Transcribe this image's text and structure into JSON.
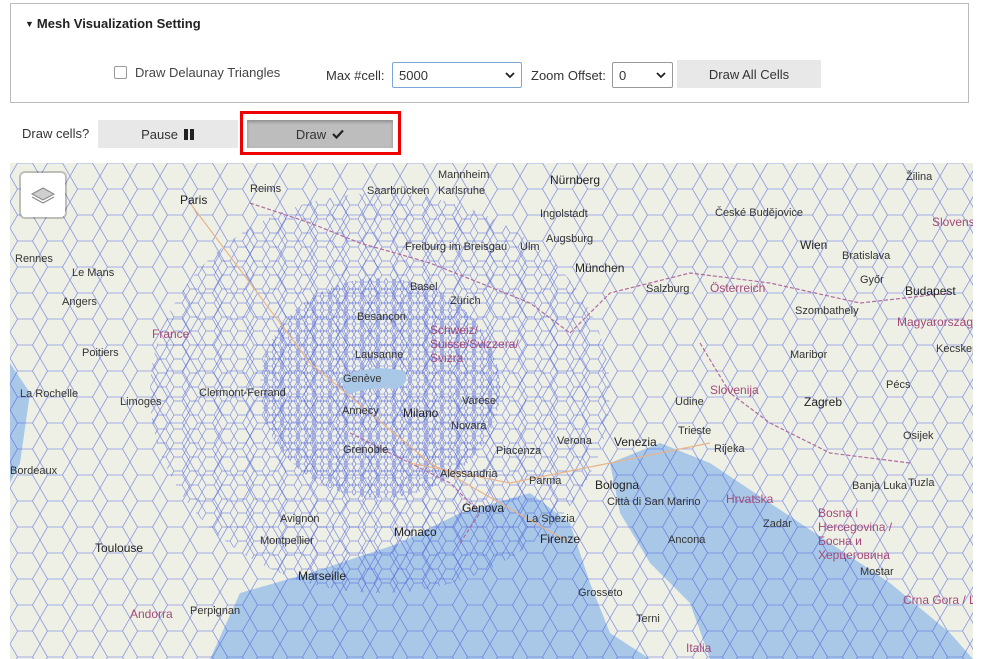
{
  "panel": {
    "title": "Mesh Visualization Setting",
    "draw_delaunay_label": "Draw Delaunay Triangles",
    "max_cell_label": "Max #cell:",
    "max_cell_value": "5000",
    "zoom_offset_label": "Zoom Offset:",
    "zoom_offset_value": "0",
    "draw_all_cells_label": "Draw All Cells"
  },
  "draw_controls": {
    "label": "Draw cells?",
    "pause_label": "Pause",
    "draw_label": "Draw"
  },
  "map": {
    "places": [
      {
        "name": "Paris",
        "cls": "big"
      },
      {
        "name": "Reims",
        "cls": ""
      },
      {
        "name": "Saarbrücken",
        "cls": ""
      },
      {
        "name": "Karlsruhe",
        "cls": ""
      },
      {
        "name": "Mannheim",
        "cls": ""
      },
      {
        "name": "Nürnberg",
        "cls": "big"
      },
      {
        "name": "Ingolstadt",
        "cls": ""
      },
      {
        "name": "Augsburg",
        "cls": ""
      },
      {
        "name": "München",
        "cls": "big"
      },
      {
        "name": "Ulm",
        "cls": ""
      },
      {
        "name": "Freiburg im Breisgau",
        "cls": ""
      },
      {
        "name": "Basel",
        "cls": ""
      },
      {
        "name": "Zürich",
        "cls": ""
      },
      {
        "name": "Besançon",
        "cls": ""
      },
      {
        "name": "Schweiz/ Suisse/Svizzera/ Svizra",
        "cls": "country"
      },
      {
        "name": "Lausanne",
        "cls": ""
      },
      {
        "name": "Genève",
        "cls": ""
      },
      {
        "name": "Annecy",
        "cls": ""
      },
      {
        "name": "Grenoble",
        "cls": ""
      },
      {
        "name": "Varese",
        "cls": ""
      },
      {
        "name": "Novara",
        "cls": ""
      },
      {
        "name": "Milano",
        "cls": "big"
      },
      {
        "name": "Verona",
        "cls": ""
      },
      {
        "name": "Venezia",
        "cls": "big"
      },
      {
        "name": "Piacenza",
        "cls": ""
      },
      {
        "name": "Alessandria",
        "cls": ""
      },
      {
        "name": "Parma",
        "cls": ""
      },
      {
        "name": "Bologna",
        "cls": "big"
      },
      {
        "name": "Genova",
        "cls": "big"
      },
      {
        "name": "La Spezia",
        "cls": ""
      },
      {
        "name": "Firenze",
        "cls": "big"
      },
      {
        "name": "Monaco",
        "cls": "big"
      },
      {
        "name": "Marseille",
        "cls": "big"
      },
      {
        "name": "Avignon",
        "cls": ""
      },
      {
        "name": "Montpellier",
        "cls": ""
      },
      {
        "name": "Toulouse",
        "cls": "big"
      },
      {
        "name": "Perpignan",
        "cls": ""
      },
      {
        "name": "Andorra",
        "cls": "country"
      },
      {
        "name": "Rennes",
        "cls": ""
      },
      {
        "name": "Le Mans",
        "cls": ""
      },
      {
        "name": "Angers",
        "cls": ""
      },
      {
        "name": "Poitiers",
        "cls": ""
      },
      {
        "name": "La Rochelle",
        "cls": ""
      },
      {
        "name": "Limoges",
        "cls": ""
      },
      {
        "name": "Clermont-Ferrand",
        "cls": ""
      },
      {
        "name": "Bordeaux",
        "cls": ""
      },
      {
        "name": "France",
        "cls": "country"
      },
      {
        "name": "Salzburg",
        "cls": ""
      },
      {
        "name": "Österreich",
        "cls": "country"
      },
      {
        "name": "Wien",
        "cls": "big"
      },
      {
        "name": "Bratislava",
        "cls": ""
      },
      {
        "name": "Győr",
        "cls": ""
      },
      {
        "name": "Budapest",
        "cls": "big"
      },
      {
        "name": "Szombathely",
        "cls": ""
      },
      {
        "name": "Magyarország",
        "cls": "country"
      },
      {
        "name": "Kecskemét",
        "cls": ""
      },
      {
        "name": "Maribor",
        "cls": ""
      },
      {
        "name": "Slovenija",
        "cls": "country"
      },
      {
        "name": "Zagreb",
        "cls": "big"
      },
      {
        "name": "Pécs",
        "cls": ""
      },
      {
        "name": "Osijek",
        "cls": ""
      },
      {
        "name": "Udine",
        "cls": ""
      },
      {
        "name": "Trieste",
        "cls": ""
      },
      {
        "name": "Rijeka",
        "cls": ""
      },
      {
        "name": "Hrvatska",
        "cls": "country"
      },
      {
        "name": "Banja Luka",
        "cls": ""
      },
      {
        "name": "Tuzla",
        "cls": ""
      },
      {
        "name": "Bosna i Hercegovina / Босна и Херцеговина",
        "cls": "country"
      },
      {
        "name": "Zadar",
        "cls": ""
      },
      {
        "name": "Mostar",
        "cls": ""
      },
      {
        "name": "Crna Gora / Црна Гора",
        "cls": "country"
      },
      {
        "name": "Città di San Marino",
        "cls": ""
      },
      {
        "name": "Ancona",
        "cls": ""
      },
      {
        "name": "Grosseto",
        "cls": ""
      },
      {
        "name": "Terni",
        "cls": ""
      },
      {
        "name": "Italia",
        "cls": "country"
      },
      {
        "name": "České Budějovice",
        "cls": ""
      },
      {
        "name": "Žilina",
        "cls": ""
      },
      {
        "name": "Slovensko",
        "cls": "country"
      }
    ]
  },
  "colors": {
    "highlight": "#e00000",
    "mesh": "#3b4fd8",
    "sea": "#a9c8e8",
    "land": "#eef0e6"
  }
}
